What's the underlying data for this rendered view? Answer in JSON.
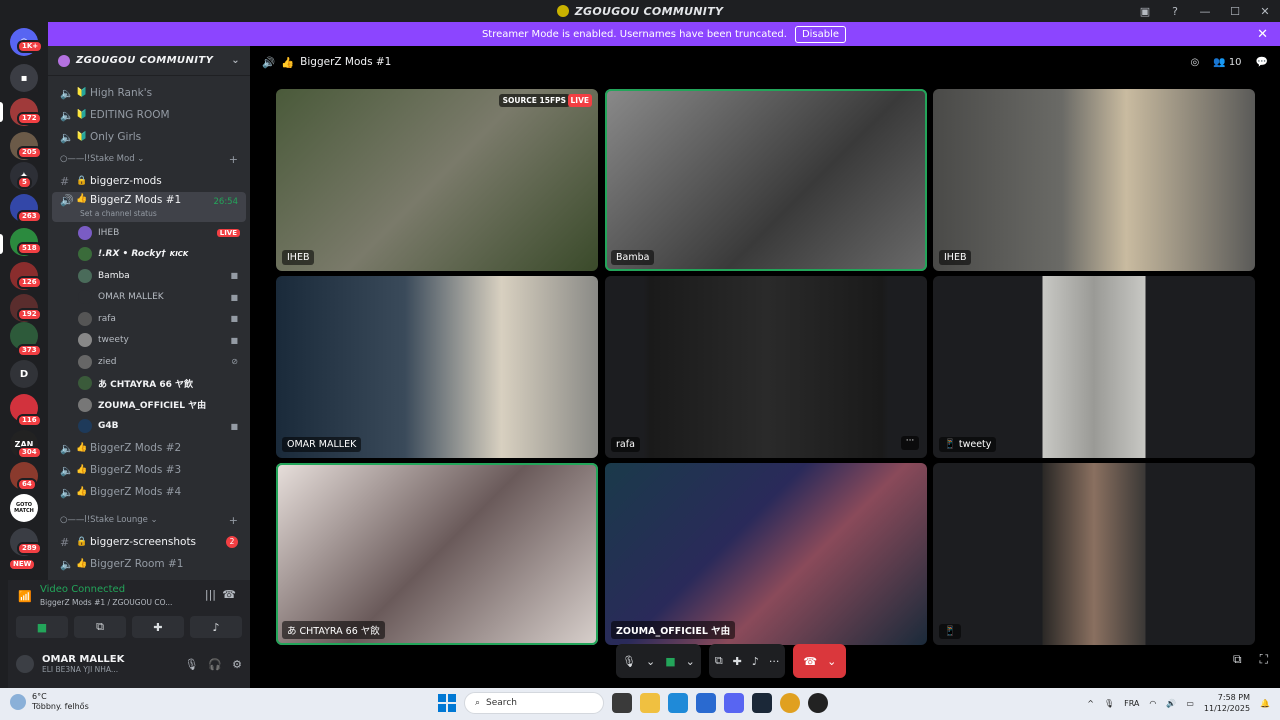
{
  "window": {
    "title": "ZGOUGOU COMMUNITY"
  },
  "banner": {
    "message": "Streamer Mode is enabled. Usernames have been truncated.",
    "disable_label": "Disable",
    "close": "✕"
  },
  "rail": {
    "badges": [
      "1K+",
      "172",
      "205",
      "5",
      "263",
      "518",
      "126",
      "192",
      "373",
      "116",
      "304",
      "64",
      "289",
      "NEW"
    ],
    "letter": "D",
    "labels": [
      "ZAN",
      "GOTO MATCH"
    ]
  },
  "guild": {
    "name": "ZGOUGOU COMMUNITY",
    "chevron": "⌄"
  },
  "channels_top": [
    {
      "name": "High Rank's"
    },
    {
      "name": "EDITING ROOM"
    },
    {
      "name": "Only Girls"
    }
  ],
  "category1": {
    "name": "○——l!Stake Mod ⌄",
    "plus": "+"
  },
  "text_channel1": {
    "name": "biggerz-mods"
  },
  "active_voice": {
    "name": "BiggerZ Mods #1",
    "time": "26:54",
    "status": "Set a channel status"
  },
  "voice_users": [
    {
      "name": "IHEB",
      "live": "LIVE"
    },
    {
      "name": "!.RX • Rocky†",
      "tag": "KICK"
    },
    {
      "name": "Bamba"
    },
    {
      "name": "OMAR MALLEK"
    },
    {
      "name": "rafa"
    },
    {
      "name": "tweety"
    },
    {
      "name": "zied"
    },
    {
      "name": "あ CHTAYRA 66 ヤ飲"
    },
    {
      "name": "ZOUMA_OFFICIEL ヤ由"
    },
    {
      "name": "G4B"
    }
  ],
  "channels_more": [
    {
      "name": "BiggerZ Mods #2"
    },
    {
      "name": "BiggerZ Mods #3"
    },
    {
      "name": "BiggerZ Mods #4"
    }
  ],
  "category2": {
    "name": "○——l!Stake Lounge ⌄",
    "plus": "+"
  },
  "text_channel2": {
    "name": "biggerz-screenshots",
    "badge": "2"
  },
  "partial_channel": {
    "name": "BiggerZ Room #1"
  },
  "voice_panel": {
    "status": "Video Connected",
    "channel": "BiggerZ Mods #1 / ZGOUGOU CO...",
    "user_name": "OMAR MALLEK",
    "user_status": "ELI BE3NA YJI NHA..."
  },
  "main": {
    "channel_title": "BiggerZ Mods #1",
    "participants_count": "10"
  },
  "tiles": [
    {
      "label": "IHEB",
      "source": "SOURCE 15FPS",
      "live": "LIVE"
    },
    {
      "label": "Bamba"
    },
    {
      "label": "IHEB"
    },
    {
      "label": "OMAR MALLEK"
    },
    {
      "label": "rafa",
      "dots": "···"
    },
    {
      "label": "tweety"
    },
    {
      "label": "あ CHTAYRA 66 ヤ飲"
    },
    {
      "label": "ZOUMA_OFFICIEL ヤ由"
    },
    {
      "label": ""
    }
  ],
  "taskbar": {
    "temp": "6°C",
    "weather_desc": "Többny. felhős",
    "search_placeholder": "Search",
    "lang": "FRA",
    "time": "7:58 PM",
    "date": "11/12/2025"
  },
  "colors": {
    "banner": "#8c45ff",
    "speaking": "#23a55a",
    "live": "#f23f43",
    "hangup": "#da373c"
  }
}
